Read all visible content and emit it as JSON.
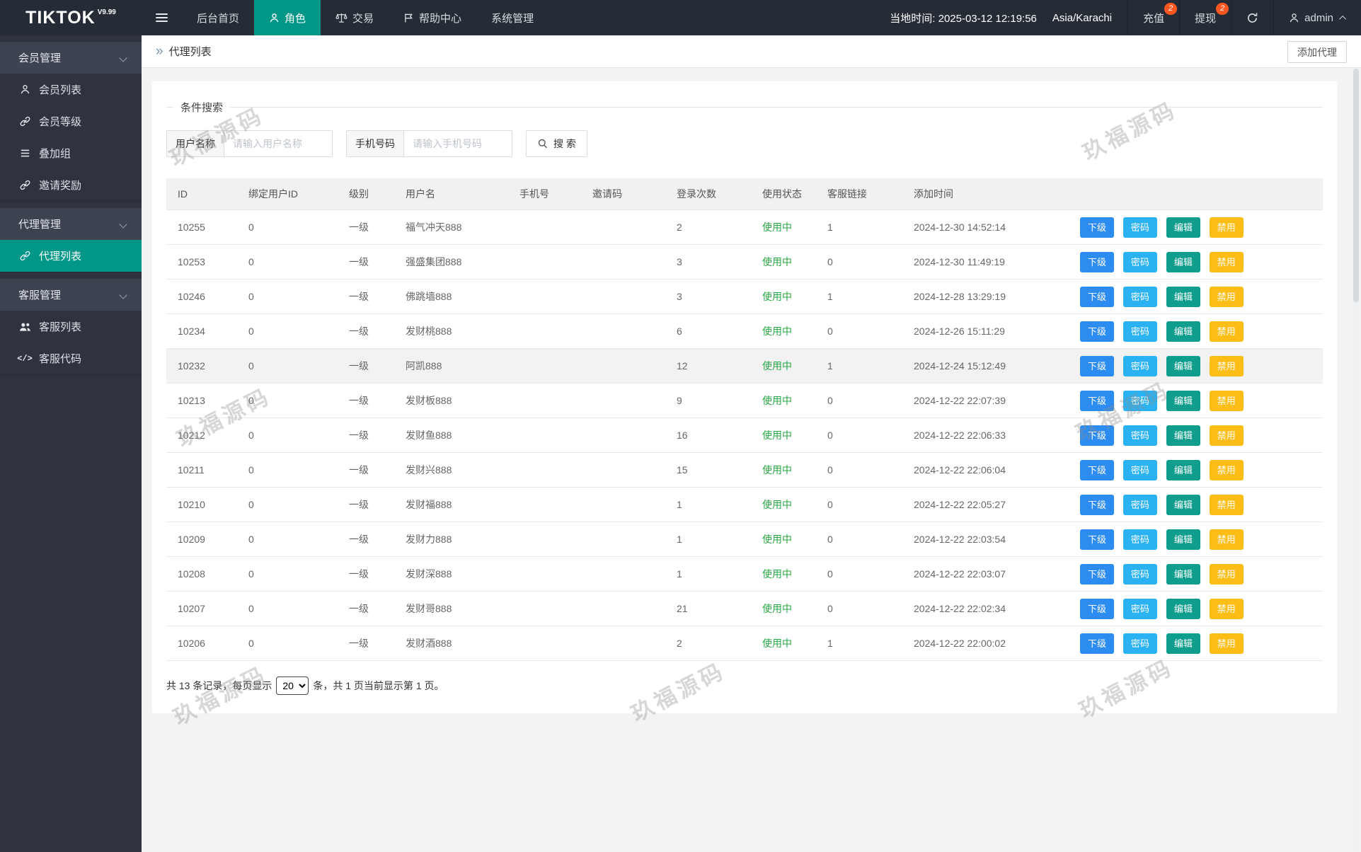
{
  "navbar": {
    "logo": "TIKTOK",
    "logo_version": "V9.99",
    "items": [
      {
        "label": "后台首页"
      },
      {
        "label": "角色",
        "active": true
      },
      {
        "label": "交易"
      },
      {
        "label": "帮助中心"
      },
      {
        "label": "系统管理"
      }
    ],
    "local_time": "当地时间: 2025-03-12 12:19:56",
    "timezone": "Asia/Karachi",
    "recharge": {
      "label": "充值",
      "badge": "2"
    },
    "withdraw": {
      "label": "提现",
      "badge": "2"
    },
    "username": "admin"
  },
  "sidebar": {
    "groups": [
      {
        "label": "会员管理",
        "items": [
          {
            "label": "会员列表",
            "icon": "user-icon"
          },
          {
            "label": "会员等级",
            "icon": "link-icon"
          },
          {
            "label": "叠加组",
            "icon": "list-icon"
          },
          {
            "label": "邀请奖励",
            "icon": "link-icon"
          }
        ]
      },
      {
        "label": "代理管理",
        "items": [
          {
            "label": "代理列表",
            "icon": "link-icon",
            "active": true
          }
        ]
      },
      {
        "label": "客服管理",
        "items": [
          {
            "label": "客服列表",
            "icon": "users-icon"
          },
          {
            "label": "客服代码",
            "icon": "code-icon"
          }
        ]
      }
    ]
  },
  "page": {
    "breadcrumb": "代理列表",
    "add_button": "添加代理"
  },
  "search": {
    "legend": "条件搜索",
    "username_label": "用户名称",
    "username_placeholder": "请输入用户名称",
    "username_value": "",
    "phone_label": "手机号码",
    "phone_placeholder": "请输入手机号码",
    "phone_value": "",
    "button_label": "搜 索"
  },
  "table": {
    "headers": [
      "ID",
      "绑定用户ID",
      "级别",
      "用户名",
      "手机号",
      "邀请码",
      "登录次数",
      "使用状态",
      "客服链接",
      "添加时间",
      ""
    ],
    "action_labels": [
      "下级",
      "密码",
      "编辑",
      "禁用"
    ],
    "highlighted_row_id": "10232",
    "rows": [
      {
        "id": "10255",
        "bind_user_id": "0",
        "level": "一级",
        "username": "福气冲天888",
        "phone": "",
        "invite_code": "",
        "login_count": "2",
        "status": "使用中",
        "cs_link": "1",
        "added_time": "2024-12-30 14:52:14"
      },
      {
        "id": "10253",
        "bind_user_id": "0",
        "level": "一级",
        "username": "强盛集团888",
        "phone": "",
        "invite_code": "",
        "login_count": "3",
        "status": "使用中",
        "cs_link": "0",
        "added_time": "2024-12-30 11:49:19"
      },
      {
        "id": "10246",
        "bind_user_id": "0",
        "level": "一级",
        "username": "佛跳墙888",
        "phone": "",
        "invite_code": "",
        "login_count": "3",
        "status": "使用中",
        "cs_link": "1",
        "added_time": "2024-12-28 13:29:19"
      },
      {
        "id": "10234",
        "bind_user_id": "0",
        "level": "一级",
        "username": "发财桃888",
        "phone": "",
        "invite_code": "",
        "login_count": "6",
        "status": "使用中",
        "cs_link": "0",
        "added_time": "2024-12-26 15:11:29"
      },
      {
        "id": "10232",
        "bind_user_id": "0",
        "level": "一级",
        "username": "阿凯888",
        "phone": "",
        "invite_code": "",
        "login_count": "12",
        "status": "使用中",
        "cs_link": "1",
        "added_time": "2024-12-24 15:12:49"
      },
      {
        "id": "10213",
        "bind_user_id": "0",
        "level": "一级",
        "username": "发财板888",
        "phone": "",
        "invite_code": "",
        "login_count": "9",
        "status": "使用中",
        "cs_link": "0",
        "added_time": "2024-12-22 22:07:39"
      },
      {
        "id": "10212",
        "bind_user_id": "0",
        "level": "一级",
        "username": "发财鱼888",
        "phone": "",
        "invite_code": "",
        "login_count": "16",
        "status": "使用中",
        "cs_link": "0",
        "added_time": "2024-12-22 22:06:33"
      },
      {
        "id": "10211",
        "bind_user_id": "0",
        "level": "一级",
        "username": "发财兴888",
        "phone": "",
        "invite_code": "",
        "login_count": "15",
        "status": "使用中",
        "cs_link": "0",
        "added_time": "2024-12-22 22:06:04"
      },
      {
        "id": "10210",
        "bind_user_id": "0",
        "level": "一级",
        "username": "发财福888",
        "phone": "",
        "invite_code": "",
        "login_count": "1",
        "status": "使用中",
        "cs_link": "0",
        "added_time": "2024-12-22 22:05:27"
      },
      {
        "id": "10209",
        "bind_user_id": "0",
        "level": "一级",
        "username": "发财力888",
        "phone": "",
        "invite_code": "",
        "login_count": "1",
        "status": "使用中",
        "cs_link": "0",
        "added_time": "2024-12-22 22:03:54"
      },
      {
        "id": "10208",
        "bind_user_id": "0",
        "level": "一级",
        "username": "发财深888",
        "phone": "",
        "invite_code": "",
        "login_count": "1",
        "status": "使用中",
        "cs_link": "0",
        "added_time": "2024-12-22 22:03:07"
      },
      {
        "id": "10207",
        "bind_user_id": "0",
        "level": "一级",
        "username": "发财哥888",
        "phone": "",
        "invite_code": "",
        "login_count": "21",
        "status": "使用中",
        "cs_link": "0",
        "added_time": "2024-12-22 22:02:34"
      },
      {
        "id": "10206",
        "bind_user_id": "0",
        "level": "一级",
        "username": "发财酒888",
        "phone": "",
        "invite_code": "",
        "login_count": "2",
        "status": "使用中",
        "cs_link": "1",
        "added_time": "2024-12-22 22:00:02"
      }
    ]
  },
  "pagination": {
    "prefix": "共 13 条记录，每页显示",
    "page_size": "20",
    "suffix": "条，共 1 页当前显示第 1 页。"
  },
  "watermark": "玖福源码",
  "colors": {
    "accent": "#009688",
    "navbar_bg": "#262c35",
    "sidebar_bg": "#2e333f",
    "sidebar_group_bg": "#3d4350",
    "badge": "#ff5722",
    "status_green": "#28a745",
    "btn_sub": "#2d8cf0",
    "btn_pwd": "#2bb2f2",
    "btn_edit": "#0f9d8d",
    "btn_disable": "#fcbd17"
  }
}
